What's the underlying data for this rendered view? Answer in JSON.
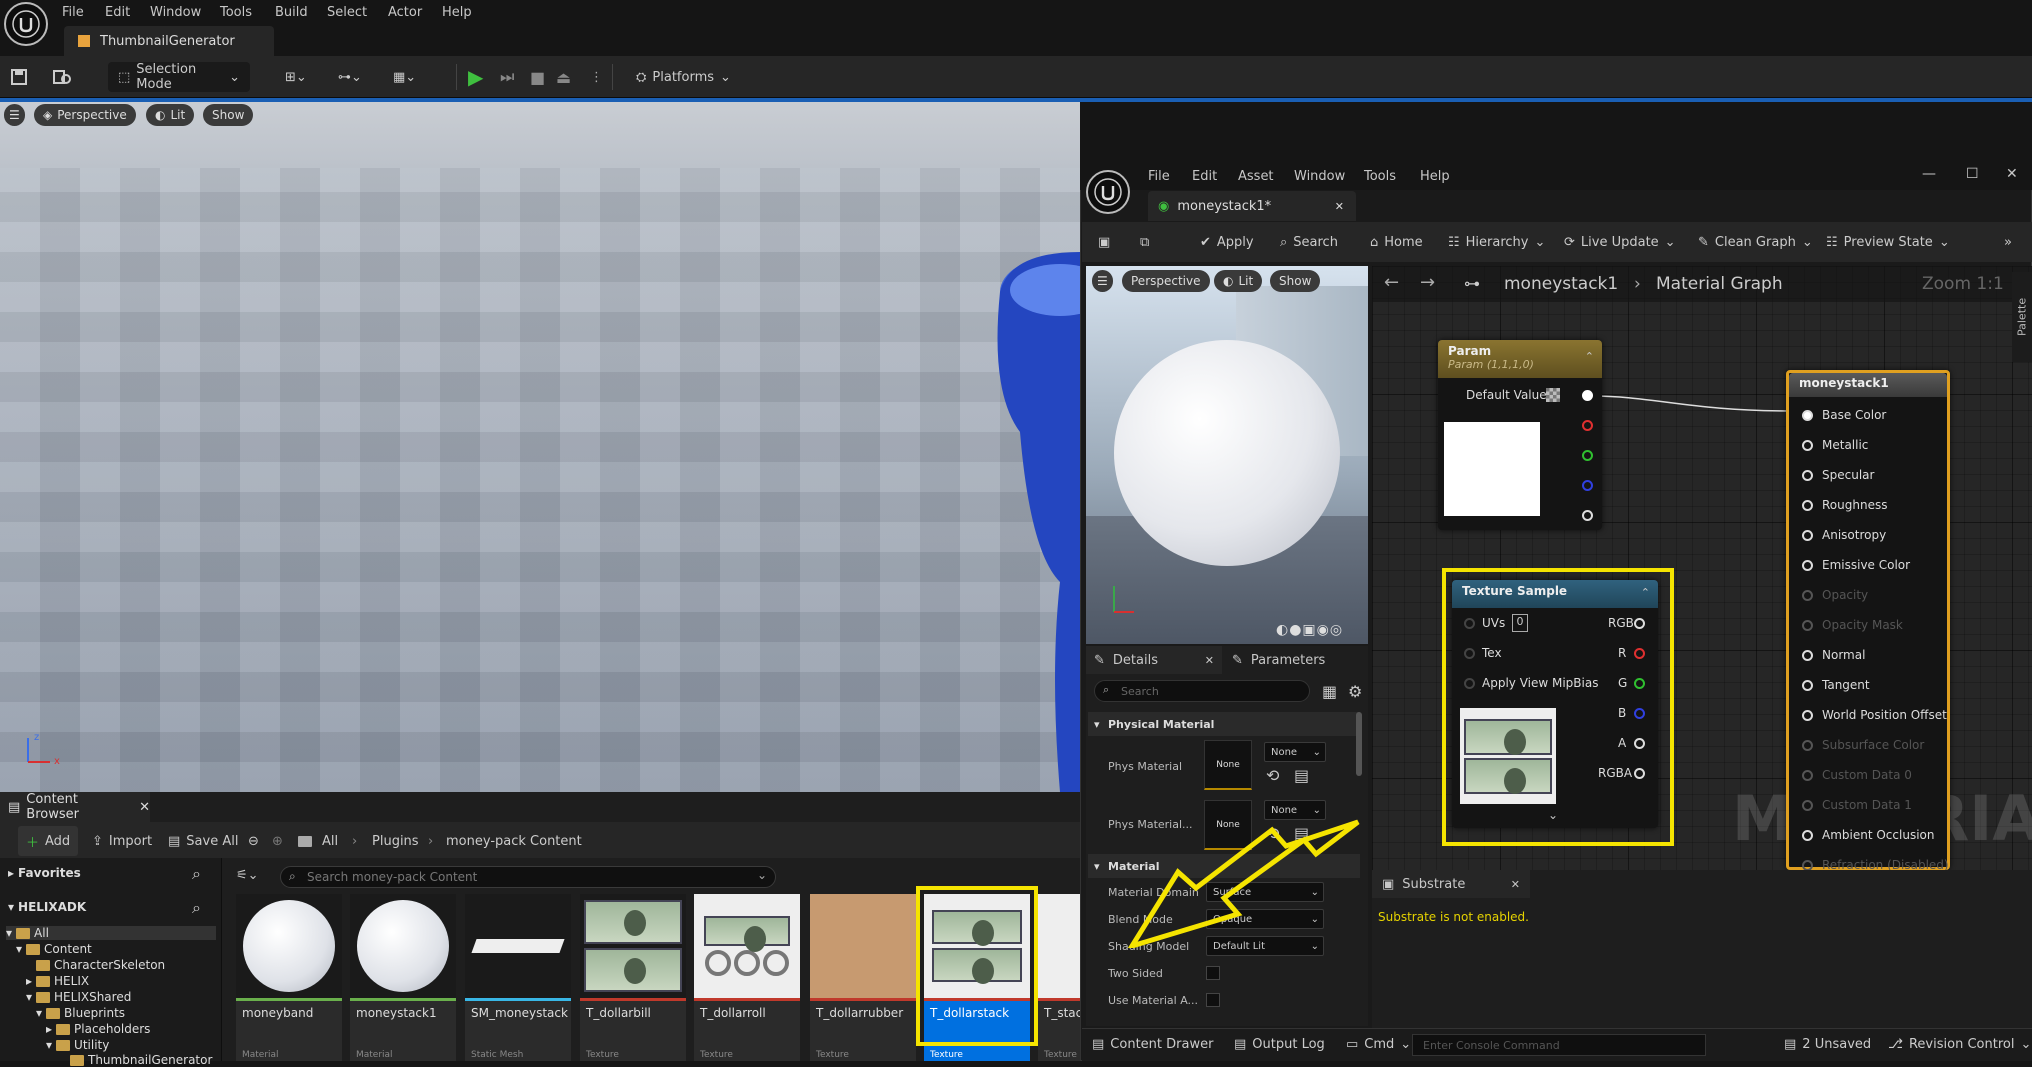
{
  "main": {
    "menu": [
      "File",
      "Edit",
      "Window",
      "Tools",
      "Build",
      "Select",
      "Actor",
      "Help"
    ],
    "tab_title": "ThumbnailGenerator",
    "toolbar": {
      "mode": "Selection Mode",
      "platforms": "Platforms"
    },
    "viewport": {
      "perspective": "Perspective",
      "lit": "Lit",
      "show": "Show",
      "axis_z": "z",
      "axis_x": "x"
    }
  },
  "content_browser": {
    "tab": "Content Browser",
    "add": "Add",
    "import": "Import",
    "save_all": "Save All",
    "breadcrumb": [
      "All",
      "Plugins",
      "money-pack Content"
    ],
    "favorites": "Favorites",
    "project": "HELIXADK",
    "search_placeholder": "Search money-pack Content",
    "tree": [
      "All",
      "Content",
      "CharacterSkeleton",
      "HELIX",
      "HELIXShared",
      "Blueprints",
      "Placeholders",
      "Utility",
      "ThumbnailGenerator"
    ],
    "assets": [
      {
        "name": "moneyband",
        "type": "Material",
        "color": "#6ab04c"
      },
      {
        "name": "moneystack1",
        "type": "Material",
        "color": "#6ab04c"
      },
      {
        "name": "SM_moneystack",
        "type": "Static Mesh",
        "color": "#39b7e6"
      },
      {
        "name": "T_dollarbill",
        "type": "Texture",
        "color": "#c0392b"
      },
      {
        "name": "T_dollarroll",
        "type": "Texture",
        "color": "#c0392b"
      },
      {
        "name": "T_dollarrubber",
        "type": "Texture",
        "color": "#c0392b"
      },
      {
        "name": "T_dollarstack",
        "type": "Texture",
        "color": "#c0392b"
      },
      {
        "name": "T_stac",
        "type": "Texture",
        "color": "#c0392b"
      }
    ],
    "drawer": "Content Drawer",
    "output_log": "Output Log",
    "cmd": "Cmd",
    "console_placeholder": "Enter Console Command",
    "unsaved": "2 Unsaved",
    "revision": "Revision Control"
  },
  "material_editor": {
    "menu": [
      "File",
      "Edit",
      "Asset",
      "Window",
      "Tools",
      "Help"
    ],
    "tab_title": "moneystack1*",
    "toolbar": [
      "Apply",
      "Search",
      "Home",
      "Hierarchy",
      "Live Update",
      "Clean Graph",
      "Preview State"
    ],
    "preview": {
      "perspective": "Perspective",
      "lit": "Lit",
      "show": "Show"
    },
    "details_tab": "Details",
    "parameters_tab": "Parameters",
    "search_placeholder": "Search",
    "sections": {
      "physical": "Physical Material",
      "material": "Material"
    },
    "props": {
      "phys_material": "Phys Material",
      "phys_material_mask": "Phys Material...",
      "none": "None",
      "material_domain": "Material Domain",
      "material_domain_value": "Surface",
      "blend_mode": "Blend Mode",
      "blend_mode_value": "Opaque",
      "shading_model": "Shading Model",
      "shading_model_value": "Default Lit",
      "two_sided": "Two Sided",
      "use_material": "Use Material A..."
    },
    "graph": {
      "breadcrumb_asset": "moneystack1",
      "breadcrumb_graph": "Material Graph",
      "zoom": "Zoom 1:1",
      "palette": "Palette",
      "watermark": "MATERIAL",
      "param_node": {
        "title": "Param",
        "subtitle": "Param (1,1,1,0)",
        "default_value": "Default Value"
      },
      "texture_node": {
        "title": "Texture Sample",
        "uvs": "UVs",
        "uv_value": "0",
        "tex": "Tex",
        "mip": "Apply View MipBias",
        "outputs": [
          "RGB",
          "R",
          "G",
          "B",
          "A",
          "RGBA"
        ]
      },
      "result_node": {
        "title": "moneystack1",
        "inputs": [
          "Base Color",
          "Metallic",
          "Specular",
          "Roughness",
          "Anisotropy",
          "Emissive Color",
          "Opacity",
          "Opacity Mask",
          "Normal",
          "Tangent",
          "World Position Offset",
          "Subsurface Color",
          "Custom Data 0",
          "Custom Data 1",
          "Ambient Occlusion",
          "Refraction (Disabled)"
        ]
      }
    },
    "substrate": {
      "tab": "Substrate",
      "message": "Substrate is not enabled."
    }
  },
  "colors": {
    "accent": "#f5e400",
    "selection": "#0070e0",
    "play": "#3fbf3f"
  }
}
